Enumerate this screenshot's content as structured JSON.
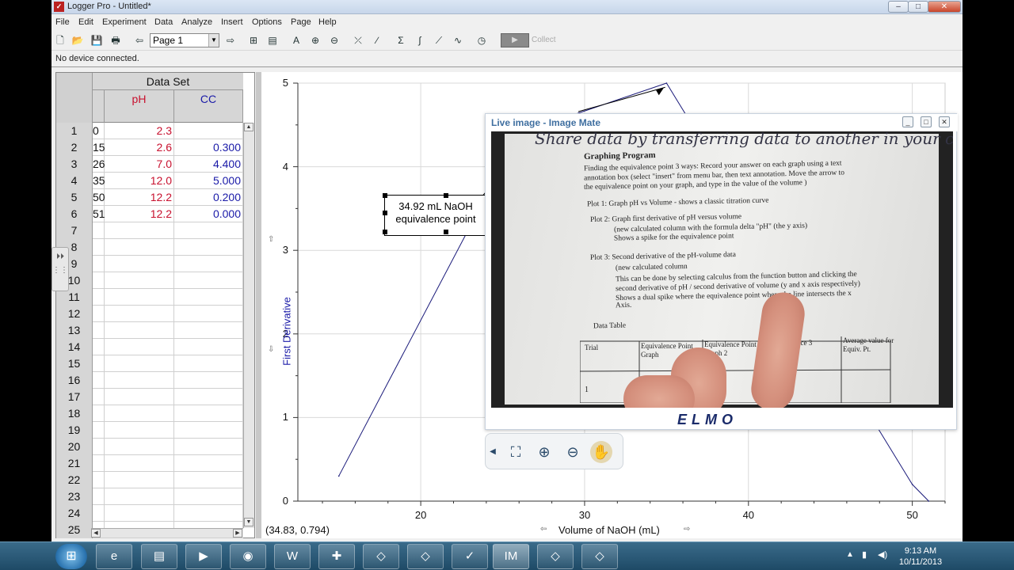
{
  "window": {
    "title": "Logger Pro - Untitled*"
  },
  "menu": [
    "File",
    "Edit",
    "Experiment",
    "Data",
    "Analyze",
    "Insert",
    "Options",
    "Page",
    "Help"
  ],
  "toolbar": {
    "page_select": "Page 1",
    "collect_label": "Collect"
  },
  "status": {
    "device": "No device connected."
  },
  "table": {
    "dataset_title": "Data Set",
    "col_ph": "pH",
    "col_cc": "CC",
    "rows": [
      {
        "n": "1",
        "vol": "0",
        "ph": "2.3",
        "cc": ""
      },
      {
        "n": "2",
        "vol": "15",
        "ph": "2.6",
        "cc": "0.300"
      },
      {
        "n": "3",
        "vol": "26",
        "ph": "7.0",
        "cc": "4.400"
      },
      {
        "n": "4",
        "vol": "35",
        "ph": "12.0",
        "cc": "5.000"
      },
      {
        "n": "5",
        "vol": "50",
        "ph": "12.2",
        "cc": "0.200"
      },
      {
        "n": "6",
        "vol": "51",
        "ph": "12.2",
        "cc": "0.000"
      },
      {
        "n": "7",
        "vol": "",
        "ph": "",
        "cc": ""
      },
      {
        "n": "8",
        "vol": "",
        "ph": "",
        "cc": ""
      },
      {
        "n": "9",
        "vol": "",
        "ph": "",
        "cc": ""
      },
      {
        "n": "10",
        "vol": "",
        "ph": "",
        "cc": ""
      },
      {
        "n": "11",
        "vol": "",
        "ph": "",
        "cc": ""
      },
      {
        "n": "12",
        "vol": "",
        "ph": "",
        "cc": ""
      },
      {
        "n": "13",
        "vol": "",
        "ph": "",
        "cc": ""
      },
      {
        "n": "14",
        "vol": "",
        "ph": "",
        "cc": ""
      },
      {
        "n": "15",
        "vol": "",
        "ph": "",
        "cc": ""
      },
      {
        "n": "16",
        "vol": "",
        "ph": "",
        "cc": ""
      },
      {
        "n": "17",
        "vol": "",
        "ph": "",
        "cc": ""
      },
      {
        "n": "18",
        "vol": "",
        "ph": "",
        "cc": ""
      },
      {
        "n": "19",
        "vol": "",
        "ph": "",
        "cc": ""
      },
      {
        "n": "20",
        "vol": "",
        "ph": "",
        "cc": ""
      },
      {
        "n": "21",
        "vol": "",
        "ph": "",
        "cc": ""
      },
      {
        "n": "22",
        "vol": "",
        "ph": "",
        "cc": ""
      },
      {
        "n": "23",
        "vol": "",
        "ph": "",
        "cc": ""
      },
      {
        "n": "24",
        "vol": "",
        "ph": "",
        "cc": ""
      },
      {
        "n": "25",
        "vol": "",
        "ph": "",
        "cc": ""
      }
    ]
  },
  "graph": {
    "y_ticks": [
      "5",
      "4",
      "3",
      "2",
      "1",
      "0"
    ],
    "x_ticks": [
      "20",
      "30",
      "40",
      "50"
    ],
    "ylabel": "First Derivative",
    "xlabel": "Volume of NaOH (mL)",
    "coord_readout": "(34.83, 0.794)",
    "annotation": [
      "34.92 mL NaOH",
      "equivalence point"
    ],
    "line_color": "#1a1a7a"
  },
  "chart_data": {
    "type": "line",
    "xlabel": "Volume of NaOH (mL)",
    "ylabel": "First Derivative",
    "xlim": [
      12.5,
      52
    ],
    "ylim": [
      0,
      5
    ],
    "series": [
      {
        "x": [
          15,
          26,
          35,
          50,
          51
        ],
        "y": [
          0.3,
          4.4,
          5.0,
          0.2,
          0.0
        ]
      }
    ]
  },
  "imagemate": {
    "title": "Live image - Image Mate",
    "brand": "ELMO",
    "handwriting": "Share data by transferring data to another in your calculator",
    "doc_lines": [
      "Graphing Program",
      "Finding the equivalence point 3 ways:  Record your answer on each graph using a text",
      "annotation box  (select \"insert\" from menu bar, then text annotation.  Move the arrow to",
      "the equivalence point on your graph, and type in the value of the volume )",
      "Plot 1:  Graph pH vs Volume - shows a classic titration curve",
      "Plot 2:  Graph first derivative of pH versus volume",
      "(new calculated column with the formula delta \"pH\" (the y axis)",
      "Shows a spike for the equivalence point",
      "Plot 3:  Second derivative of the pH-volume data",
      "(new calculated column",
      "This can be done by selecting calculus from the function button and clicking the",
      "second derivative of pH / second derivative of volume (y and x axis respectively)",
      "Shows a dual spike where the equivalence point where the line intersects the x",
      "Axis.",
      "Data Table"
    ],
    "table_headers": [
      "Trial",
      "Equivalence Point Graph",
      "Equivalence Point Graph 2",
      "Equivalence 3",
      "Average value for Equiv. Pt."
    ],
    "table_row1": "1"
  },
  "taskbar": {
    "time": "9:13 AM",
    "date": "10/11/2013",
    "apps": [
      "Internet Explorer",
      "Windows Explorer",
      "Media Player",
      "Chrome",
      "Word",
      "App",
      "App",
      "App",
      "Logger Pro",
      "Image Mate",
      "App",
      "App"
    ]
  }
}
